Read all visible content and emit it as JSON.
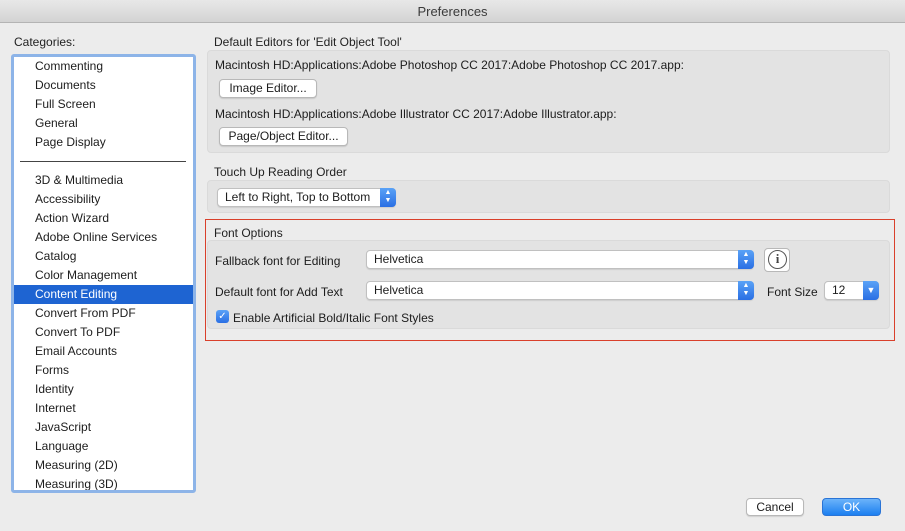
{
  "window": {
    "title": "Preferences"
  },
  "categories": {
    "label": "Categories:",
    "group1": [
      "Commenting",
      "Documents",
      "Full Screen",
      "General",
      "Page Display"
    ],
    "group2": [
      "3D & Multimedia",
      "Accessibility",
      "Action Wizard",
      "Adobe Online Services",
      "Catalog",
      "Color Management",
      "Content Editing",
      "Convert From PDF",
      "Convert To PDF",
      "Email Accounts",
      "Forms",
      "Identity",
      "Internet",
      "JavaScript",
      "Language",
      "Measuring (2D)",
      "Measuring (3D)"
    ],
    "selected": "Content Editing"
  },
  "default_editors": {
    "title": "Default Editors for 'Edit Object Tool'",
    "image_path": "Macintosh HD:Applications:Adobe Photoshop CC 2017:Adobe Photoshop CC 2017.app:",
    "image_button": "Image Editor...",
    "page_path": "Macintosh HD:Applications:Adobe Illustrator CC 2017:Adobe Illustrator.app:",
    "page_button": "Page/Object Editor..."
  },
  "reading_order": {
    "title": "Touch Up Reading Order",
    "value": "Left to Right, Top to Bottom"
  },
  "font_options": {
    "title": "Font Options",
    "fallback_label": "Fallback font for Editing",
    "fallback_value": "Helvetica",
    "default_label": "Default font for Add Text",
    "default_value": "Helvetica",
    "size_label": "Font Size",
    "size_value": "12",
    "checkbox_label": "Enable Artificial Bold/Italic Font Styles",
    "checkbox_checked": true
  },
  "footer": {
    "cancel": "Cancel",
    "ok": "OK"
  },
  "colors": {
    "accent": "#1e64d2",
    "highlight": "#d9402b"
  }
}
